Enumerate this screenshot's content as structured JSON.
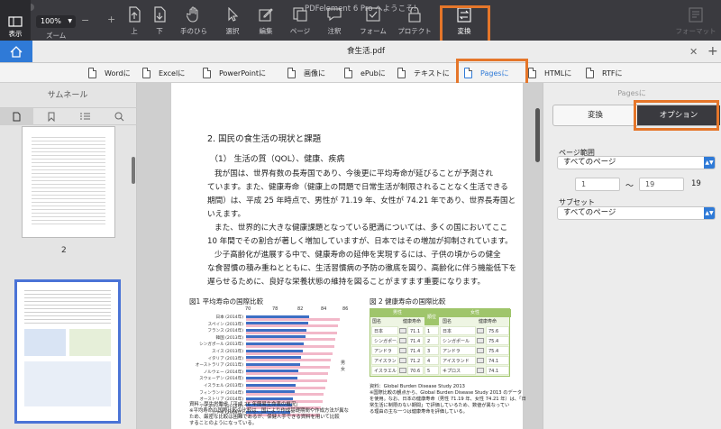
{
  "app": {
    "title": "PDFelement 6 Pro へようこそ!"
  },
  "toolbar": {
    "view": "表示",
    "zoom_value": "100%",
    "zoom": "ズーム",
    "up": "上",
    "down": "下",
    "hand": "手のひら",
    "select": "選択",
    "edit": "編集",
    "page": "ページ",
    "comment": "注釈",
    "form": "フォーム",
    "protect": "プロテクト",
    "convert": "変換",
    "format": "フォーマット"
  },
  "tab": {
    "filename": "食生活.pdf"
  },
  "convert_bar": {
    "word": "Wordに",
    "excel": "Excelに",
    "powerpoint": "PowerPointに",
    "image": "画像に",
    "epub": "ePubに",
    "text": "テキストに",
    "pages": "Pagesに",
    "html": "HTMLに",
    "rtf": "RTFに"
  },
  "sidebar": {
    "title": "サムネール",
    "page_number": "2"
  },
  "document": {
    "heading": "2.  国民の食生活の現状と課題",
    "subheading": "（1） 生活の質（QOL）、健康、疾病",
    "p1": [
      "我が国は、世界有数の長寿国であり、今後更に平均寿命が延びることが予測され",
      "ています。また、健康寿命（健康上の問題で日常生活が制限されることなく生活できる",
      "期間）は、平成 25 年時点で、男性が 71.19 年、女性が 74.21 年であり、世界長寿国と",
      "いえます。"
    ],
    "p2": [
      "また、世界的に大きな健康課題となっている肥満については、多くの国においてここ",
      "10 年間でその割合が著しく増加していますが、日本ではその増加が抑制されています。"
    ],
    "p3": [
      "少子高齢化が進展する中で、健康寿命の延伸を実現するには、子供の頃からの健全",
      "な食習慣の積み重ねとともに、生活習慣病の予防の徹底を図り、高齢化に伴う機能低下を",
      "遅らせるために、良好な栄養状態の維持を図ることがますます重要になります。"
    ],
    "fig1_title": "図1  平均寿命の国際比較",
    "fig1_axis": [
      "70",
      "78",
      "82",
      "84",
      "86"
    ],
    "fig1_labels": [
      "日本 (2014年)",
      "スペイン (2013年)",
      "フランス (2014年)",
      "韓国 (2013年)",
      "シンガポール (2013年)",
      "スイス (2013年)",
      "イタリア (2013年)",
      "オーストラリア (2011年)",
      "ノルウェー (2014年)",
      "スウェーデン (2014年)",
      "イスラエル (2013年)",
      "フィンランド (2014年)",
      "オーストリア (2014年)",
      "アイスランド (2014年)",
      "カナダ (2009年)"
    ],
    "fig1_legend": [
      "男",
      "女"
    ],
    "fig1_notes": [
      "資料：厚生労働省「平成 26 年簡易生命表の概況」",
      "※平均寿命の国際比較の比較は、国により作成基礎期間や作成方法が異な",
      "ため、厳密な比較は困難であるが、保健人手できる資料を用いて比較",
      "することのようになっている。"
    ],
    "fig2_title": "図 2  健康寿命の国際比較",
    "fig2_headers": {
      "male": "男性",
      "female": "女性",
      "rank": "順位",
      "country": "国名",
      "value": "健康寿命"
    },
    "fig2_rows": [
      {
        "m": "日本",
        "mv": "71.1",
        "r": "1",
        "f": "日本",
        "fv": "75.6"
      },
      {
        "m": "シンガポール",
        "mv": "71.4",
        "r": "2",
        "f": "シンガポール",
        "fv": "75.4"
      },
      {
        "m": "アンドラ",
        "mv": "71.4",
        "r": "3",
        "f": "アンドラ",
        "fv": "75.4"
      },
      {
        "m": "アイスランド",
        "mv": "71.2",
        "r": "4",
        "f": "アイスランド",
        "fv": "74.1"
      },
      {
        "m": "イスラエル",
        "mv": "70.6",
        "r": "5",
        "f": "キプロス",
        "fv": "74.1"
      }
    ],
    "fig2_notes": [
      "資料：Global Burden Disease Study 2013",
      "※国際比較の観点から、Global Burden Disease Study 2013 のデータ",
      "を使用。なお、日本の健康寿命（男性 71.19 年、女性 74.21 年）は、「日",
      "常生活に制限のない期間」で評価しているため、数値が異なってい",
      "る理由の主な一つは健康寿命を評価している。"
    ]
  },
  "panel": {
    "header": "Pagesに",
    "tab_convert": "変換",
    "tab_option": "オプション",
    "page_range_label": "ページ範囲",
    "page_range_value": "すべてのページ",
    "from": "1",
    "to": "19",
    "total": "19",
    "subset_label": "サブセット",
    "subset_value": "すべてのページ"
  },
  "colors": {
    "accent": "#e5762a",
    "toolbar": "#3a3a3f",
    "blue": "#2f7ad7"
  }
}
